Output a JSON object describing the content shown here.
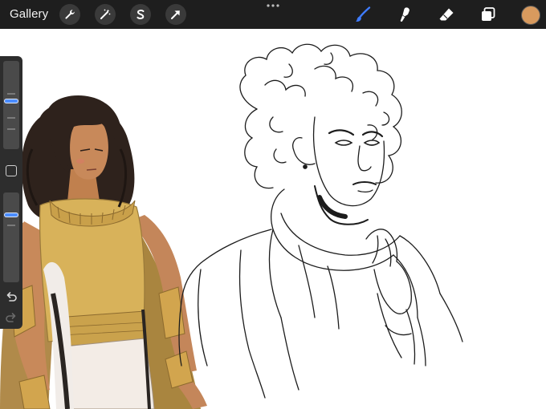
{
  "topbar": {
    "gallery_label": "Gallery",
    "left_tools": [
      "wrench-icon",
      "magic-wand-icon",
      "selection-s-icon",
      "arrow-transform-icon"
    ],
    "right_tools": [
      "brush-icon",
      "smudge-icon",
      "eraser-icon",
      "layers-icon"
    ],
    "active_tool": "brush-icon",
    "current_color": "#d89a5e"
  },
  "sidebar": {
    "brush_size_level": 0.6,
    "opacity_level": 0.8
  },
  "colors": {
    "toolbar_bg": "#1e1e1e",
    "accent_blue": "#3f7cff",
    "skin_tone": "#c88a5a",
    "gold_fabric": "#d8b25a",
    "hair_dark": "#2e221c"
  }
}
